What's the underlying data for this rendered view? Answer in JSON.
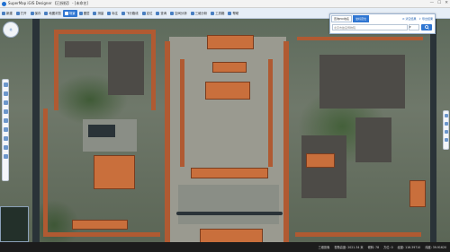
{
  "window": {
    "title": "SuperMap iGIS Designer 【已授权】 - [未命名]",
    "controls": [
      "—",
      "☐",
      "✕"
    ]
  },
  "toolbar": {
    "items": [
      {
        "label": "新建",
        "icon": "new-icon",
        "active": false
      },
      {
        "label": "打开",
        "icon": "open-icon",
        "active": false
      },
      {
        "label": "保存",
        "icon": "save-icon",
        "active": false
      },
      {
        "label": "地图浏览",
        "icon": "map-browse-icon",
        "active": false
      },
      {
        "label": "场景",
        "icon": "scene-icon",
        "active": true
      },
      {
        "label": "图层",
        "icon": "layer-icon",
        "active": false
      },
      {
        "label": "测量",
        "icon": "measure-icon",
        "active": false
      },
      {
        "label": "标注",
        "icon": "mark-icon",
        "active": false
      },
      {
        "label": "飞行路线",
        "icon": "flight-icon",
        "active": false
      },
      {
        "label": "定位",
        "icon": "locate-icon",
        "active": false
      },
      {
        "label": "查询",
        "icon": "query-icon",
        "active": false
      },
      {
        "label": "空间分析",
        "icon": "analysis-icon",
        "active": false
      },
      {
        "label": "三维分析",
        "icon": "3d-analysis-icon",
        "active": false
      },
      {
        "label": "工具箱",
        "icon": "toolbox-icon",
        "active": false
      },
      {
        "label": "帮助",
        "icon": "help-icon",
        "active": false
      }
    ]
  },
  "search_panel": {
    "tabs": [
      {
        "label": "查询POI地名",
        "active": false
      },
      {
        "label": "坐标定位",
        "active": true
      }
    ],
    "links": [
      "清空结果",
      "导出结果"
    ],
    "input_placeholder": "北京市故宫博物院",
    "select_value": "▾"
  },
  "compass": {
    "label": "北"
  },
  "status": {
    "items": [
      "三维影像",
      "视角高度: 2021.34 米",
      "倾斜: 78",
      "方位: 0",
      "经度: 116.39710",
      "纬度: 39.91620"
    ]
  }
}
